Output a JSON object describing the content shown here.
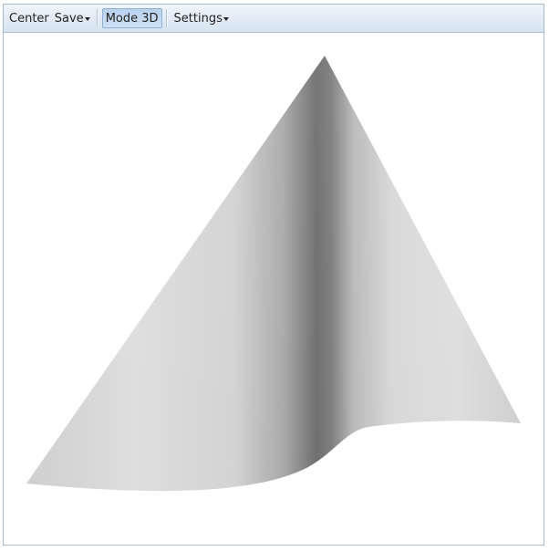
{
  "toolbar": {
    "center_label": "Center",
    "save_label": "Save",
    "mode_label": "Mode 3D",
    "mode_pressed": true,
    "settings_label": "Settings"
  },
  "icons": {
    "save_menu": "caret-down-icon",
    "settings_menu": "caret-down-icon"
  },
  "colors": {
    "frame_border": "#a7bccf",
    "toolbar_top": "#eef4fb",
    "toolbar_bottom": "#d7e3f1",
    "pressed_button": "#b8d1ee",
    "surface_light": "#dcdcdc",
    "surface_dark": "#6e6e6e"
  }
}
